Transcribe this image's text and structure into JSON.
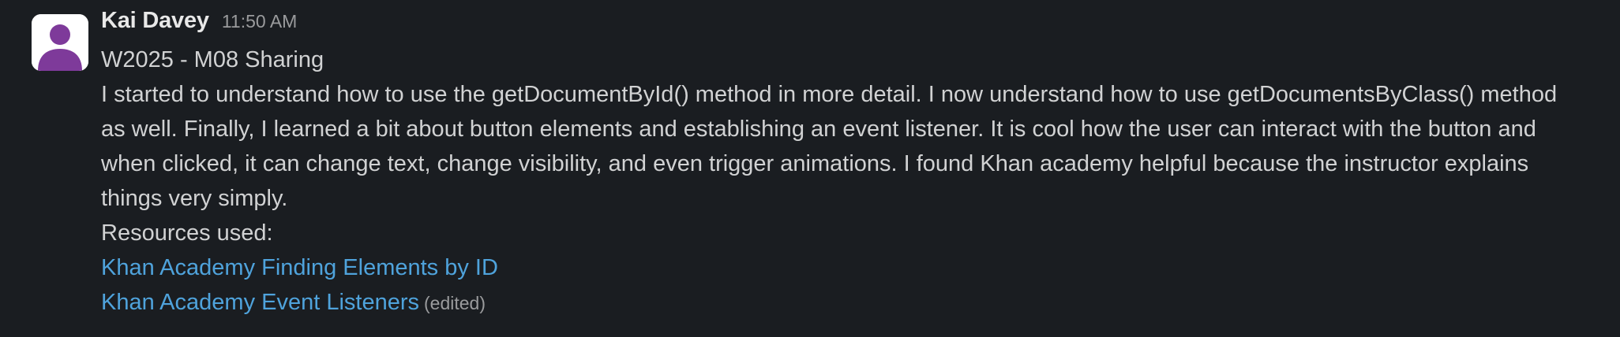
{
  "message": {
    "author": "Kai Davey",
    "timestamp": "11:50 AM",
    "title_line": "W2025 - M08 Sharing",
    "body_lines": [
      "I started to understand how to use the getDocumentById() method in more detail. I now understand how to use getDocumentsByClass() method",
      "as well. Finally, I learned a bit about button elements and establishing an event listener. It is cool how the user can interact with the button and",
      "when clicked, it can change text, change visibility, and even trigger animations. I found Khan academy helpful because the instructor explains",
      "things very simply."
    ],
    "resources_label": "Resources used:",
    "links": [
      {
        "text": "Khan Academy Finding Elements by ID"
      },
      {
        "text": "Khan Academy Event Listeners"
      }
    ],
    "edited_label": "(edited)",
    "link_color": "#4fa3dc",
    "avatar_color": "#7e3a9a",
    "avatar_icon": "user-silhouette-icon"
  }
}
